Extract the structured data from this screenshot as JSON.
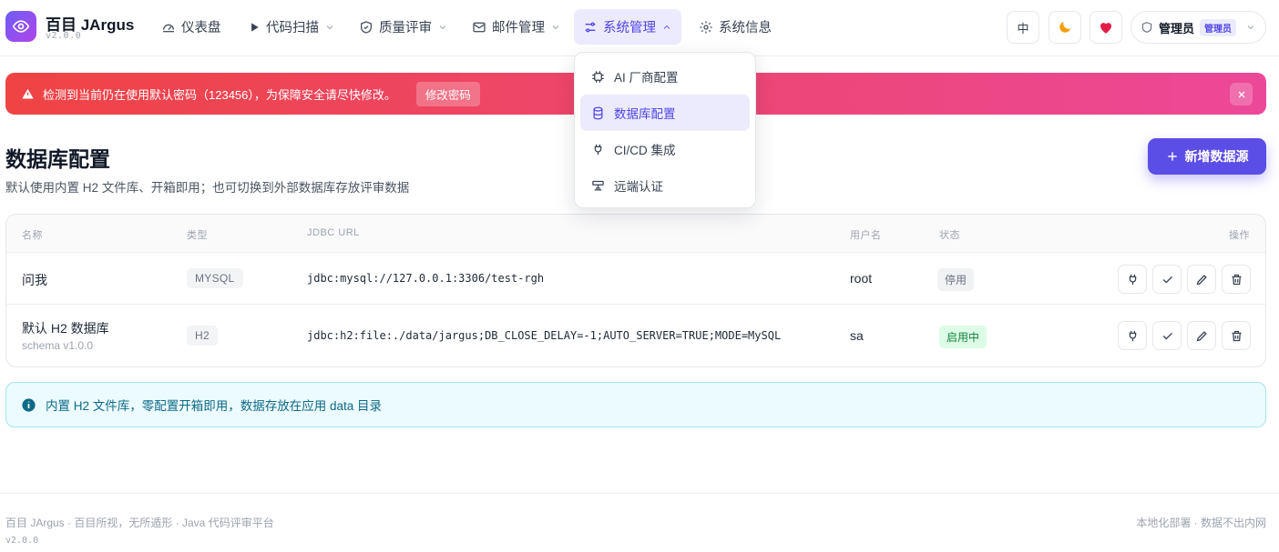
{
  "brand": {
    "name": "百目 JArgus",
    "version": "v2.0.0"
  },
  "nav": {
    "items": [
      {
        "label": "仪表盘"
      },
      {
        "label": "代码扫描"
      },
      {
        "label": "质量评审"
      },
      {
        "label": "邮件管理"
      },
      {
        "label": "系统管理"
      },
      {
        "label": "系统信息"
      }
    ]
  },
  "topbar": {
    "lang": "中",
    "user": "管理员",
    "role": "管理员"
  },
  "alert": {
    "text": "检测到当前仍在使用默认密码（123456），为保障安全请尽快修改。",
    "action": "修改密码"
  },
  "page": {
    "title": "数据库配置",
    "description": "默认使用内置 H2 文件库、开箱即用；也可切换到外部数据库存放评审数据",
    "add_button": "新增数据源"
  },
  "table": {
    "headers": [
      "名称",
      "类型",
      "JDBC URL",
      "用户名",
      "状态",
      "操作"
    ],
    "rows": [
      {
        "name": "问我",
        "sub": "",
        "type": "MYSQL",
        "url": "jdbc:mysql://127.0.0.1:3306/test-rgh",
        "user": "root",
        "status": "停用"
      },
      {
        "name": "默认 H2 数据库",
        "sub": "schema v1.0.0",
        "type": "H2",
        "url": "jdbc:h2:file:./data/jargus;DB_CLOSE_DELAY=-1;AUTO_SERVER=TRUE;MODE=MySQL",
        "user": "sa",
        "status": "启用中"
      }
    ]
  },
  "info": {
    "text": "内置 H2 文件库，零配置开箱即用，数据存放在应用 data 目录"
  },
  "footer": {
    "left": "百目 JArgus · 百目所视，无所遁形 · Java 代码评审平台",
    "version": "v2.0.0",
    "right": "本地化部署 · 数据不出内网"
  },
  "dropdown": {
    "items": [
      {
        "label": "AI 厂商配置"
      },
      {
        "label": "数据库配置"
      },
      {
        "label": "CI/CD 集成"
      },
      {
        "label": "远端认证"
      }
    ]
  },
  "colors": {
    "accent": "#5b4ee6",
    "alert_start": "#ef4444",
    "alert_end": "#ec4899",
    "success": "#15803d",
    "info": "#0e6a86"
  }
}
